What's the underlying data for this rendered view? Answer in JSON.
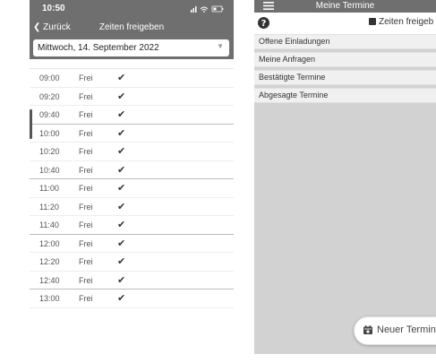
{
  "left_screen": {
    "status_time": "10:50",
    "nav": {
      "back_label": "Zurück",
      "title": "Zeiten freigeben"
    },
    "date_select": {
      "value": "Mittwoch, 14. September 2022"
    },
    "slots": [
      {
        "time": "09:00",
        "status": "Frei"
      },
      {
        "time": "09:20",
        "status": "Frei"
      },
      {
        "time": "09:40",
        "status": "Frei"
      },
      {
        "time": "10:00",
        "status": "Frei"
      },
      {
        "time": "10:20",
        "status": "Frei"
      },
      {
        "time": "10:40",
        "status": "Frei"
      },
      {
        "time": "11:00",
        "status": "Frei"
      },
      {
        "time": "11:20",
        "status": "Frei"
      },
      {
        "time": "11:40",
        "status": "Frei"
      },
      {
        "time": "12:00",
        "status": "Frei"
      },
      {
        "time": "12:20",
        "status": "Frei"
      },
      {
        "time": "12:40",
        "status": "Frei"
      },
      {
        "time": "13:00",
        "status": "Frei"
      }
    ],
    "checkmark": "✔"
  },
  "right_screen": {
    "title": "Meine Termine",
    "release_button": "Zeiten freigeb",
    "sections": [
      "Offene Einladungen",
      "Meine Anfragen",
      "Bestätigte Termine",
      "Abgesagte Termine"
    ],
    "new_button": "Neuer Termin"
  },
  "colors": {
    "header_gray": "#6f6f6f",
    "content_gray": "#d2d2d2"
  }
}
